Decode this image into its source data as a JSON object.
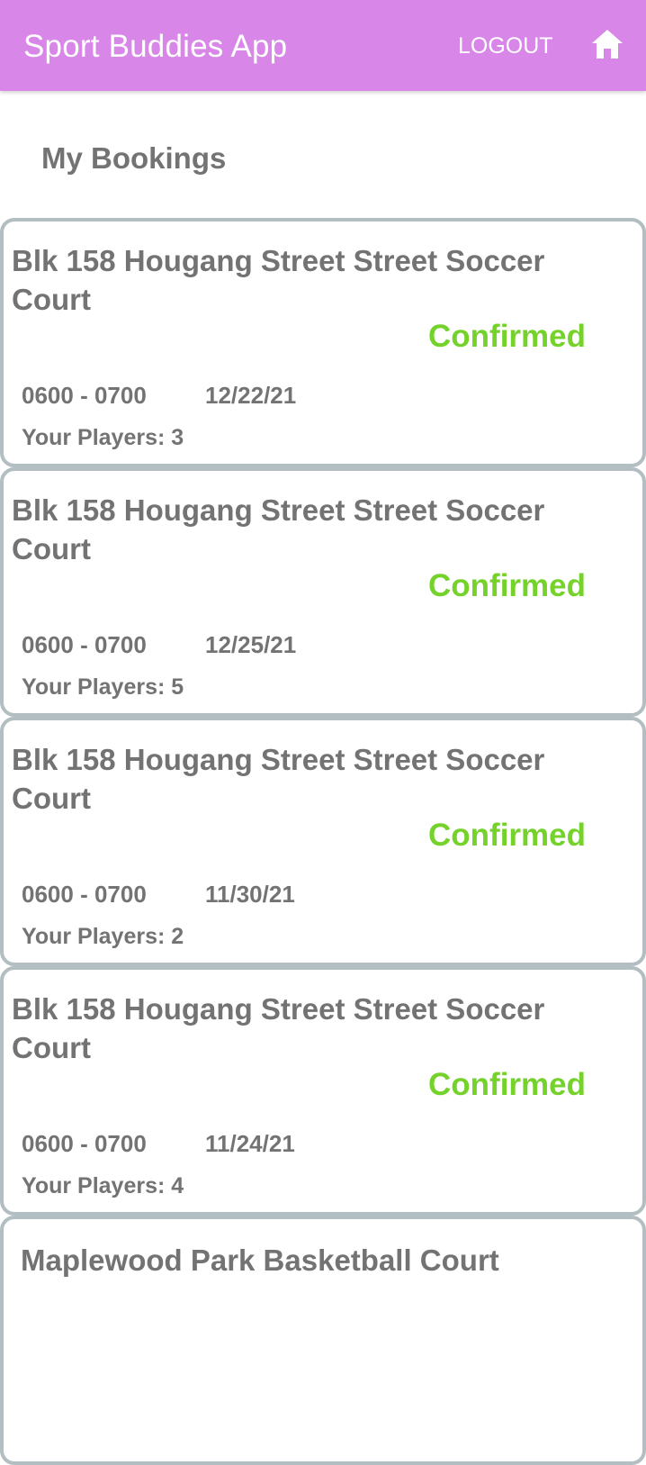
{
  "colors": {
    "accent": "#d886e8",
    "status_confirmed": "#74d22a",
    "text": "#737373",
    "card_border": "#b2bec1"
  },
  "header": {
    "title": "Sport Buddies App",
    "logout_label": "LOGOUT",
    "home_icon": "home-icon"
  },
  "page": {
    "heading": "My Bookings"
  },
  "bookings": [
    {
      "court": "Blk 158 Hougang Street Street Soccer Court",
      "status": "Confirmed",
      "time": "0600 - 0700",
      "date": "12/22/21",
      "players": "Your Players: 3"
    },
    {
      "court": "Blk 158 Hougang Street Street Soccer Court",
      "status": "Confirmed",
      "time": "0600 - 0700",
      "date": "12/25/21",
      "players": "Your Players: 5"
    },
    {
      "court": "Blk 158 Hougang Street Street Soccer Court",
      "status": "Confirmed",
      "time": "0600 - 0700",
      "date": "11/30/21",
      "players": "Your Players: 2"
    },
    {
      "court": "Blk 158 Hougang Street Street Soccer Court",
      "status": "Confirmed",
      "time": "0600 - 0700",
      "date": "11/24/21",
      "players": "Your Players: 4"
    },
    {
      "court": "Maplewood Park Basketball Court"
    }
  ]
}
